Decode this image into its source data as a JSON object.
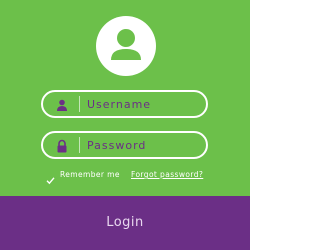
{
  "colors": {
    "background_green": "#6cc04a",
    "accent_purple": "#6b2f86",
    "white": "#ffffff"
  },
  "avatar": {
    "icon": "user-icon"
  },
  "form": {
    "username": {
      "placeholder": "Username",
      "value": "",
      "icon": "user-icon"
    },
    "password": {
      "placeholder": "Password",
      "value": "",
      "icon": "lock-icon"
    },
    "remember_label": "Remember me",
    "remember_checked": true,
    "forgot_label": "Forgot password?"
  },
  "login_label": "Login"
}
